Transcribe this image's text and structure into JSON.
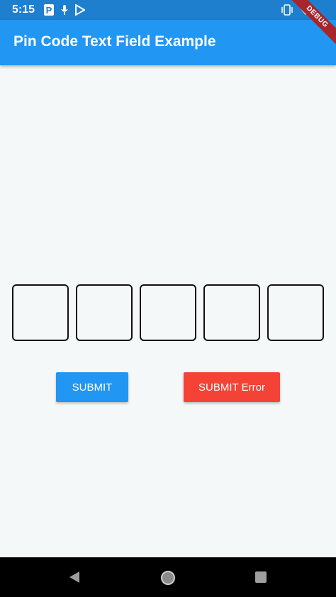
{
  "status_bar": {
    "time": "5:15",
    "left_icons": [
      "parking-icon",
      "microphone-icon",
      "play-store-icon"
    ],
    "right_icons": [
      "vibrate-icon",
      "wifi-icon"
    ]
  },
  "app_bar": {
    "title": "Pin Code Text Field Example",
    "debug_banner": "DEBUG",
    "color": "#2196f3"
  },
  "pin_field": {
    "boxes": [
      "",
      "",
      "",
      "",
      ""
    ]
  },
  "buttons": {
    "submit": {
      "label": "SUBMIT",
      "color": "#2196f3"
    },
    "submit_error": {
      "label": "SUBMIT Error",
      "color": "#f44336"
    }
  },
  "nav_bar": {
    "icons": [
      "back-icon",
      "home-icon",
      "recent-apps-icon"
    ]
  }
}
